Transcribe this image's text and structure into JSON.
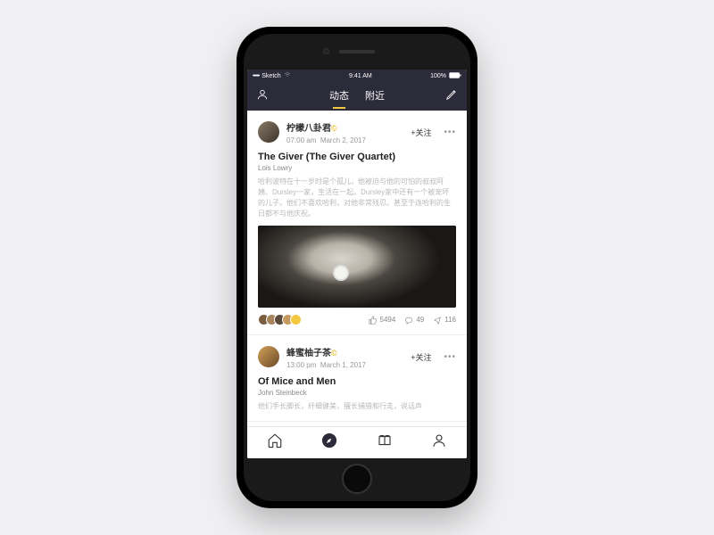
{
  "status_bar": {
    "carrier": "Sketch",
    "time": "9:41 AM",
    "battery": "100%"
  },
  "top_nav": {
    "tabs": [
      {
        "label": "动态",
        "active": true
      },
      {
        "label": "附近",
        "active": false
      }
    ]
  },
  "posts": [
    {
      "username": "柠檬八卦君",
      "verified_badge": "©",
      "time": "07:00 am",
      "date": "March 2, 2017",
      "follow_label": "+关注",
      "title": "The Giver (The Giver Quartet)",
      "author": "Lois Lowry",
      "body": "哈利波特在十一岁时是个孤儿，他被迫与他的可怕的叔叔阿姨、Dursley一家，生活在一起。Dursley家中还有一个被宠坏的儿子。他们不喜欢哈利，对他非常残忍。甚至于连哈利的生日都不与他庆祝。",
      "likes": "5494",
      "comments": "49",
      "shares": "116"
    },
    {
      "username": "蜂蜜柚子茶",
      "verified_badge": "©",
      "time": "13:00 pm",
      "date": "March 1, 2017",
      "follow_label": "+关注",
      "title": "Of Mice and Men",
      "author": "John Steinbeck",
      "body": "他们手长脚长，纤细健美，擅长捕猎和行走，说话声"
    }
  ]
}
